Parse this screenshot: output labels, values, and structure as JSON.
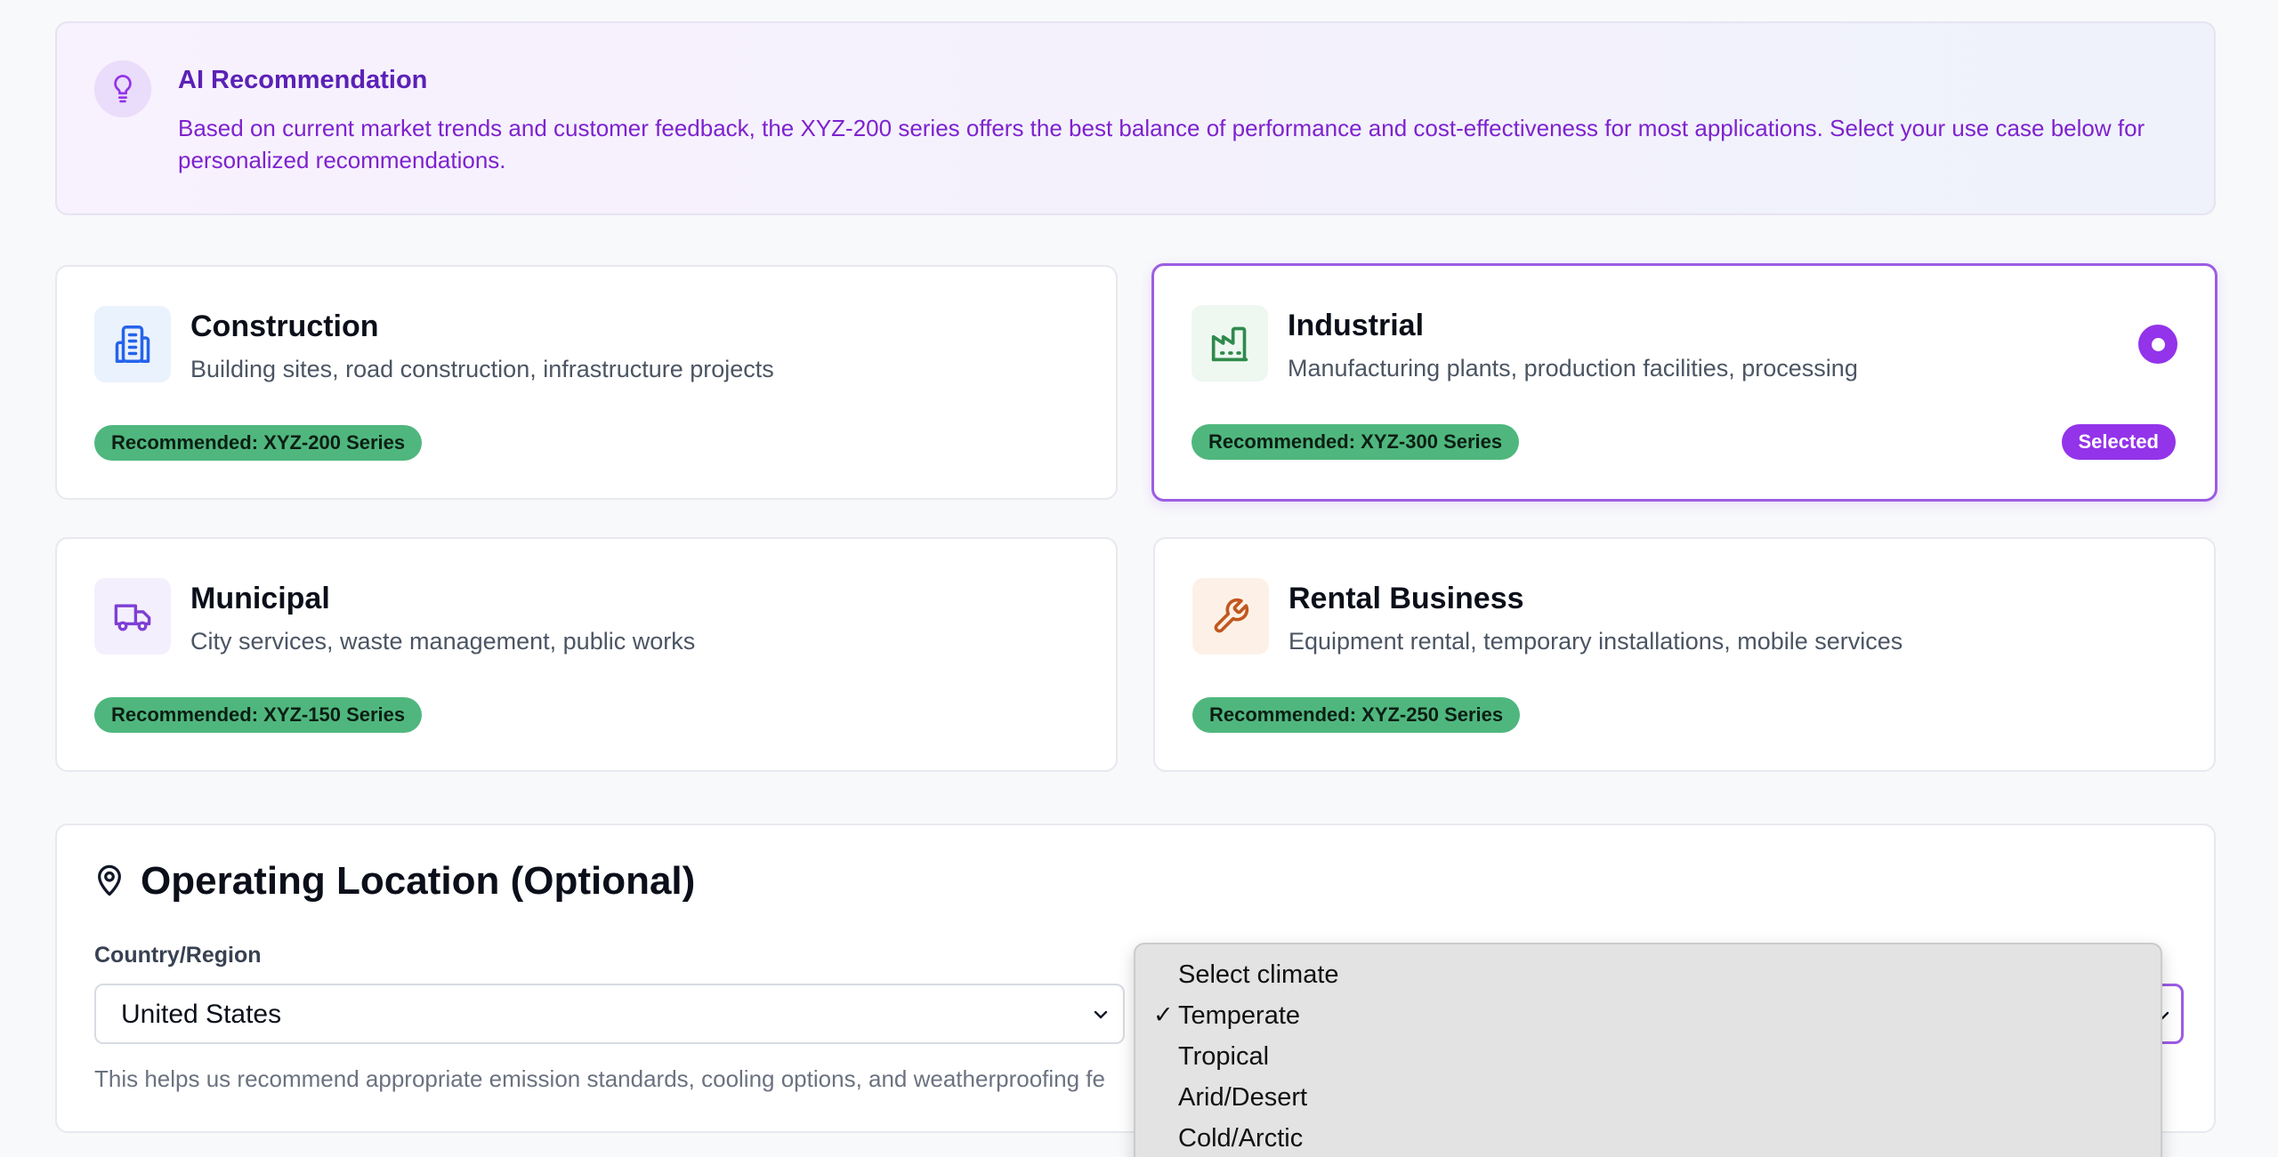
{
  "ai_recommendation": {
    "title": "AI Recommendation",
    "text": "Based on current market trends and customer feedback, the XYZ-200 series offers the best balance of performance and cost-effectiveness for most applications. Select your use case below for personalized recommendations."
  },
  "use_cases": [
    {
      "title": "Construction",
      "description": "Building sites, road construction, infrastructure projects",
      "badge": "Recommended: XYZ-200 Series",
      "icon": "building-icon",
      "selected": false
    },
    {
      "title": "Industrial",
      "description": "Manufacturing plants, production facilities, processing",
      "badge": "Recommended: XYZ-300 Series",
      "icon": "factory-icon",
      "selected": true,
      "selected_label": "Selected"
    },
    {
      "title": "Municipal",
      "description": "City services, waste management, public works",
      "badge": "Recommended: XYZ-150 Series",
      "icon": "truck-icon",
      "selected": false
    },
    {
      "title": "Rental Business",
      "description": "Equipment rental, temporary installations, mobile services",
      "badge": "Recommended: XYZ-250 Series",
      "icon": "wrench-icon",
      "selected": false
    }
  ],
  "location": {
    "heading": "Operating Location (Optional)",
    "country_label": "Country/Region",
    "country_value": "United States",
    "help_text": "This helps us recommend appropriate emission standards, cooling options, and weatherproofing fe",
    "climate_options": [
      "Select climate",
      "Temperate",
      "Tropical",
      "Arid/Desert",
      "Cold/Arctic"
    ],
    "climate_selected": "Temperate"
  },
  "colors": {
    "accent": "#9333ea",
    "recommend_badge": "#4fb77e",
    "ai_text": "#7e22ce"
  }
}
